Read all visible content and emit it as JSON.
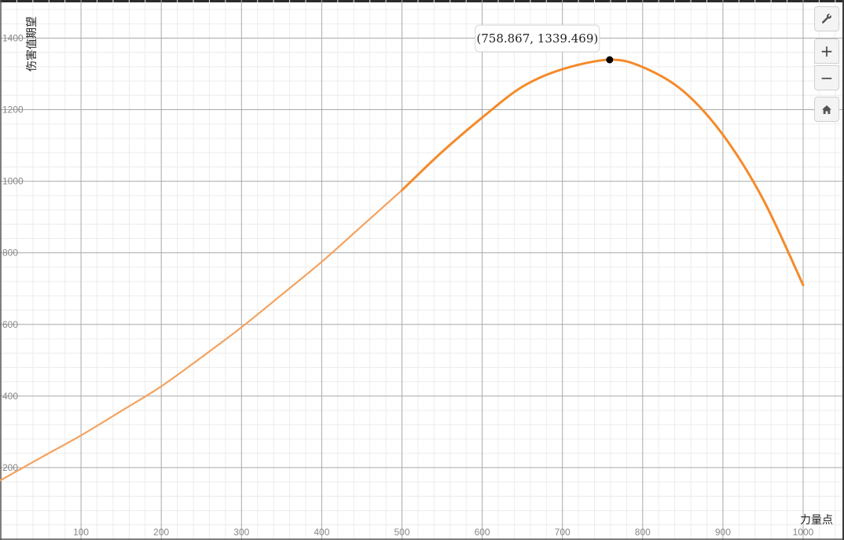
{
  "chart_data": {
    "type": "line",
    "xlabel": "力量点",
    "ylabel": "伤害值期望",
    "xlim": [
      0,
      1050
    ],
    "ylim": [
      0,
      1500
    ],
    "x_ticks": [
      "100",
      "200",
      "300",
      "400",
      "500",
      "600",
      "700",
      "800",
      "900",
      "1000"
    ],
    "y_ticks": [
      "200",
      "400",
      "600",
      "800",
      "1000",
      "1200",
      "1400"
    ],
    "grid": true,
    "series": [
      {
        "color": "#f5a25f",
        "x": [
          0,
          50,
          100,
          150,
          200,
          250,
          300,
          350,
          400,
          450,
          500
        ],
        "y": [
          165,
          228,
          290,
          358,
          427,
          508,
          592,
          683,
          775,
          875,
          975
        ]
      },
      {
        "color": "#f58a2a",
        "x": [
          500,
          550,
          600,
          650,
          700,
          758.867,
          800,
          850,
          900,
          950,
          1000
        ],
        "y": [
          975,
          1082,
          1178,
          1264,
          1313,
          1339.469,
          1319,
          1253,
          1130,
          950,
          710
        ]
      }
    ],
    "marked_point": {
      "x": 758.867,
      "y": 1339.469,
      "label": "(758.867, 1339.469)"
    }
  },
  "controls": {
    "settings_icon": "wrench-icon",
    "zoom_in_label": "+",
    "zoom_out_label": "−",
    "home_icon": "home-icon"
  }
}
